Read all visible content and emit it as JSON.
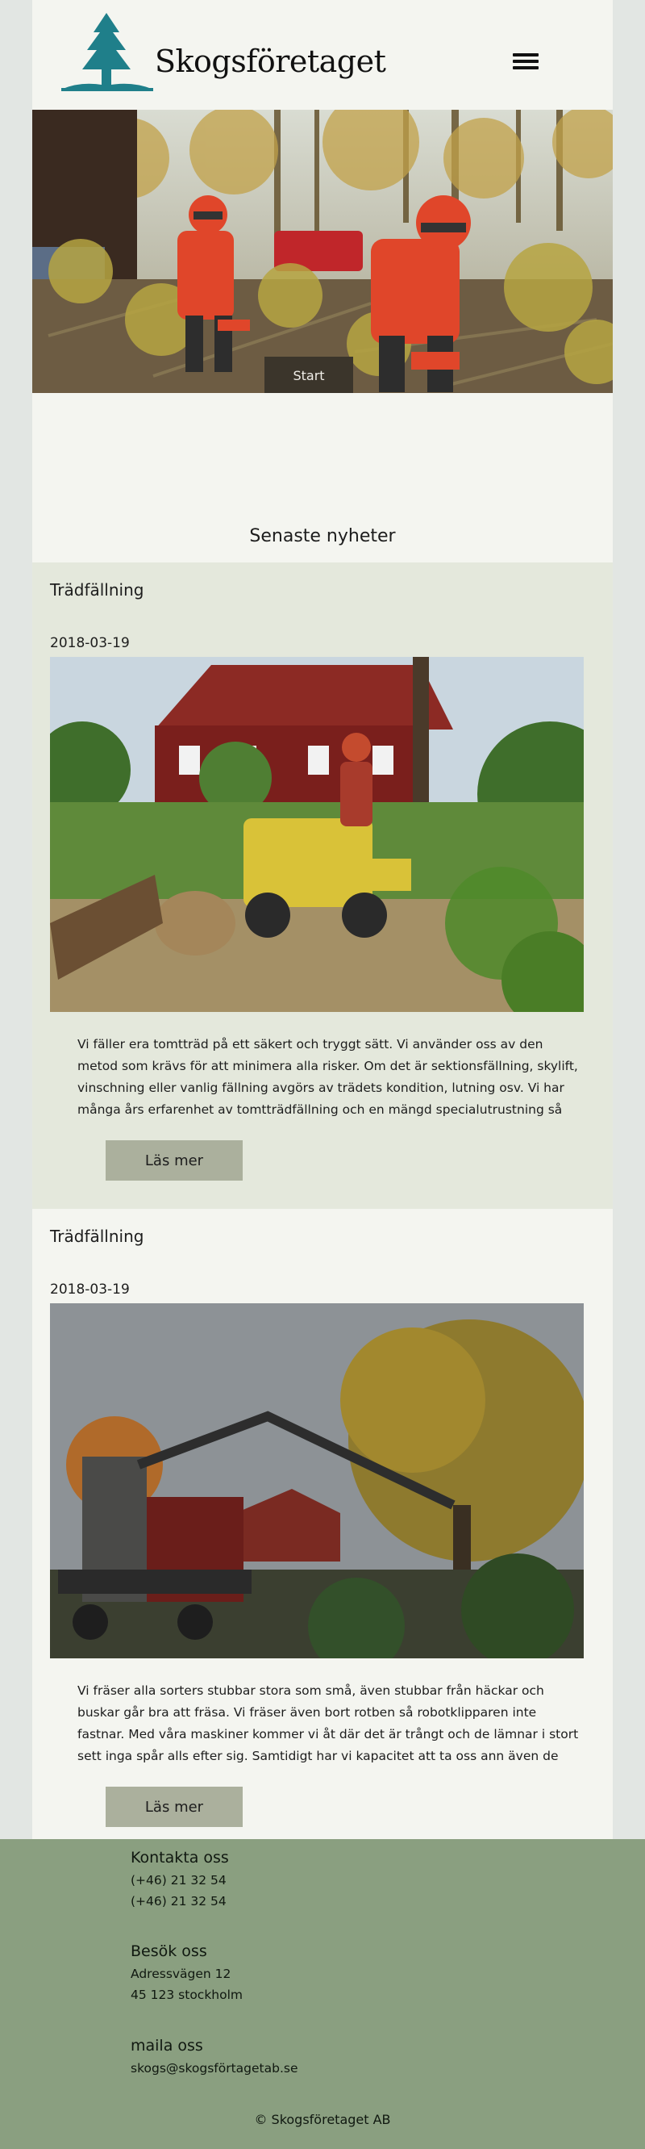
{
  "header": {
    "brand": "Skogsföretaget",
    "logo_icon": "tree-icon",
    "menu_icon": "hamburger-menu-icon"
  },
  "hero": {
    "button_label": "Start",
    "image": "two forest workers in orange helmets cutting fallen tree with chainsaws"
  },
  "news": {
    "heading": "Senaste nyheter",
    "articles": [
      {
        "title": "Trädfällning",
        "date": "2018-03-19",
        "image": "stump grinder by red wooden house",
        "text": "Vi fäller era tomtträd på ett säkert och tryggt sätt. Vi använder oss av den metod som krävs för att minimera alla risker. Om det är sektionsfällning, skylift, vinschning eller vanlig fällning avgörs av trädets kondition, lutning osv. Vi har många års erfarenhet av tomtträdfällning och en mängd specialutrustning så som",
        "button": "Läs mer"
      },
      {
        "title": "Trädfällning",
        "date": "2018-03-19",
        "image": "crane truck lifting tree in autumn",
        "text": "Vi fräser alla sorters stubbar stora som små, även stubbar från häckar och buskar går bra att fräsa. Vi fräser även bort rotben så robotklipparen inte fastnar. Med våra maskiner kommer vi åt där det är trångt och de lämnar i stort sett inga spår alls efter sig. Samtidigt har vi kapacitet att ta oss ann även de största stubbarna…",
        "button": "Läs mer"
      }
    ]
  },
  "footer": {
    "contact": {
      "heading": "Kontakta oss",
      "phone1": "(+46) 21 32 54",
      "phone2": "(+46) 21 32 54"
    },
    "visit": {
      "heading": "Besök oss",
      "street": "Adressvägen 12",
      "city": "45 123 stockholm"
    },
    "mail": {
      "heading": "maila oss",
      "email": "skogs@skogsförtagetab.se"
    },
    "copyright": "© Skogsföretaget AB"
  },
  "colors": {
    "page_bg": "#e2e6e3",
    "content_bg": "#f4f5f0",
    "article_alt_bg": "#e4e8dc",
    "button_bg": "#abb09d",
    "footer_bg": "#8a9f80",
    "logo": "#1f7f8a"
  }
}
